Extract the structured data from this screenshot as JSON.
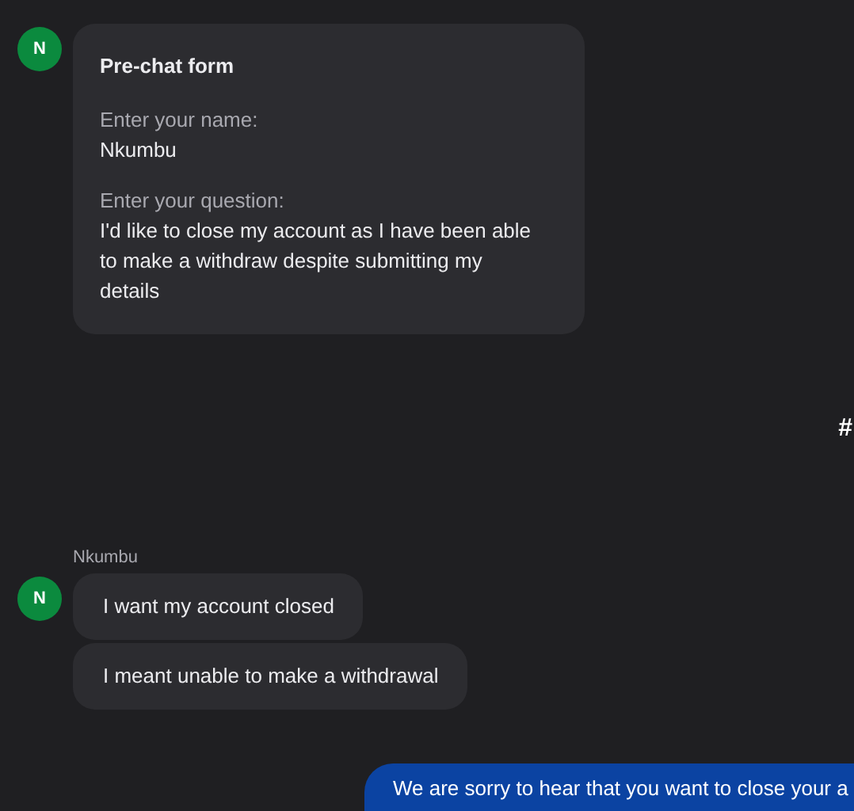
{
  "prechat_form": {
    "avatar": "N",
    "title": "Pre-chat form",
    "fields": [
      {
        "label": "Enter your name:",
        "value": "Nkumbu"
      },
      {
        "label": "Enter your question:",
        "value": "I'd like to close my account as I have been able to make a withdraw despite submitting my details"
      }
    ]
  },
  "edge_text": "#",
  "messages": [
    {
      "kind": "customer",
      "sender": "Nkumbu",
      "avatar": "N",
      "bubbles": [
        "I want my account closed",
        "I meant unable to make a withdrawal"
      ]
    },
    {
      "kind": "agent",
      "bubbles": [
        "We are sorry to hear that you want to close your a"
      ]
    }
  ]
}
